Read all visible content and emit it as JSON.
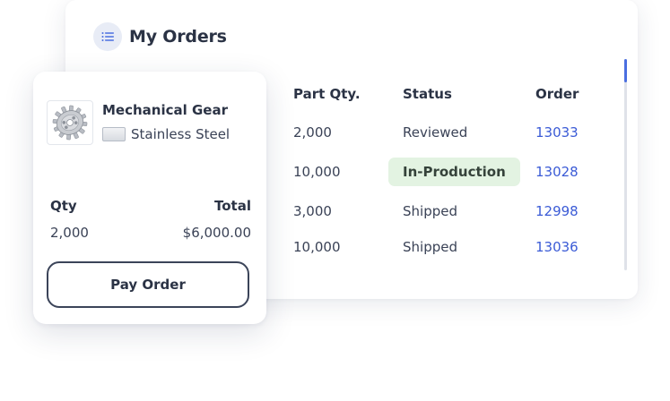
{
  "orders": {
    "title": "My Orders",
    "columns": {
      "part_qty": "Part Qty.",
      "status": "Status",
      "order": "Order"
    },
    "rows": [
      {
        "part_qty": "2,000",
        "status": "Reviewed",
        "order": "13033",
        "highlight": false
      },
      {
        "part_qty": "10,000",
        "status": "In-Production",
        "order": "13028",
        "highlight": true
      },
      {
        "part_qty": "3,000",
        "status": "Shipped",
        "order": "12998",
        "highlight": false
      },
      {
        "part_qty": "10,000",
        "status": "Shipped",
        "order": "13036",
        "highlight": false
      }
    ]
  },
  "product": {
    "name": "Mechanical Gear",
    "material": "Stainless Steel",
    "qty_label": "Qty",
    "total_label": "Total",
    "qty": "2,000",
    "total": "$6,000.00",
    "pay_button": "Pay Order"
  },
  "icons": {
    "header": "list-icon",
    "thumbnail": "gear-icon",
    "material": "material-swatch-icon"
  },
  "colors": {
    "link": "#3b5bd6",
    "badge_bg": "#e3f3e2",
    "heading": "#2b3345",
    "scroll_thumb": "#4a6ee0"
  }
}
